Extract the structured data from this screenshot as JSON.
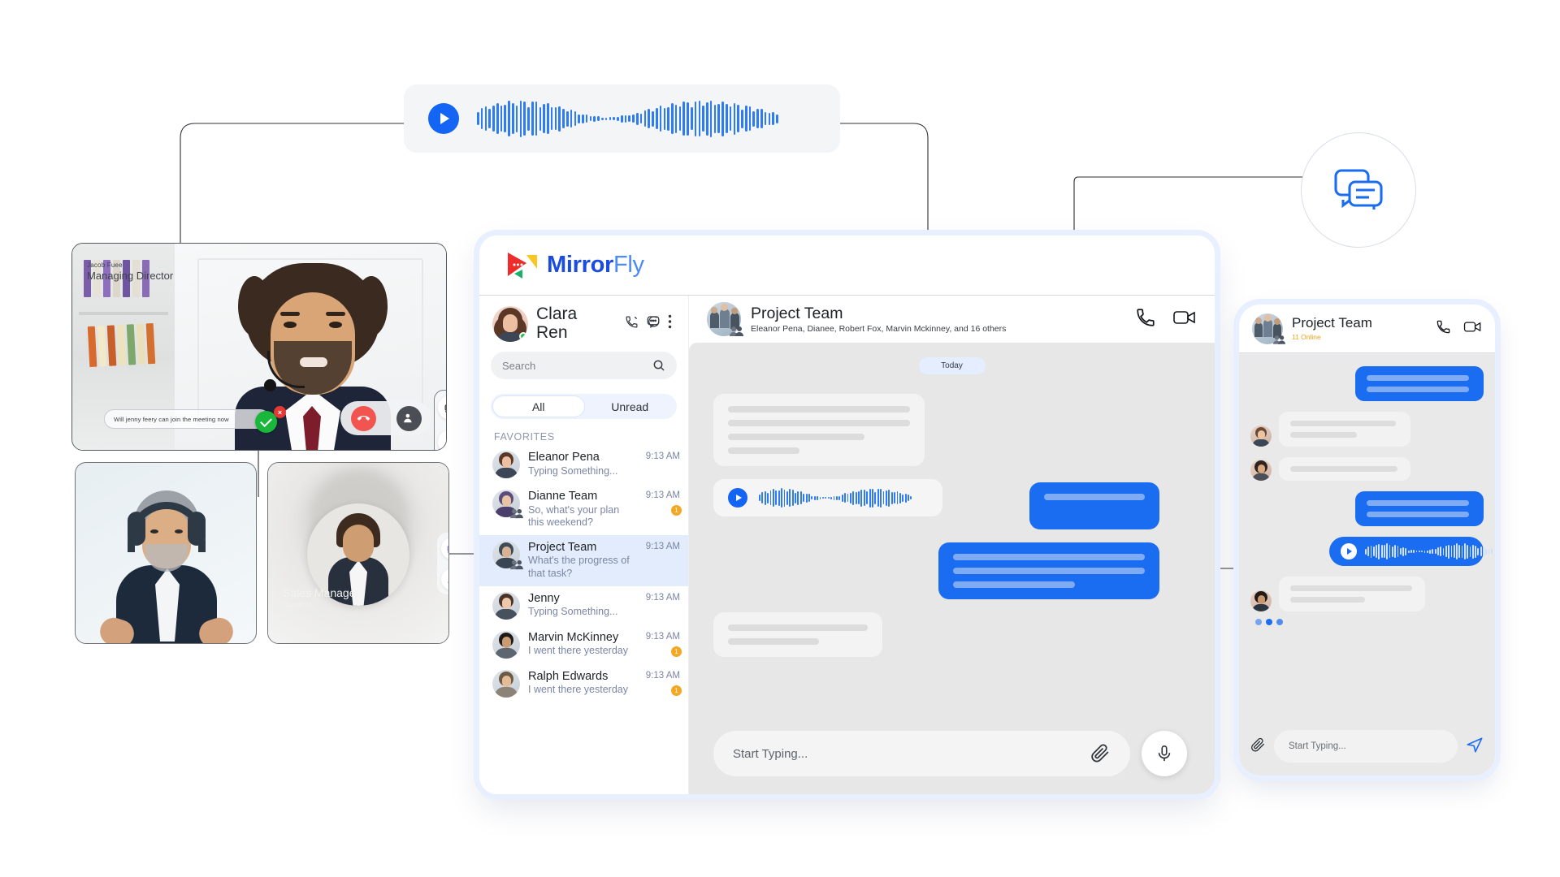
{
  "brand": {
    "name_bold": "Mirror",
    "name_light": "Fly",
    "logo_icon": "mirrorfly-logo-icon"
  },
  "audio_pill": {
    "play_icon": "play-icon",
    "waveform_icon": "audio-waveform"
  },
  "floating_chat_icon": "chat-bubbles-icon",
  "video_call": {
    "main_tile": {
      "participant_name": "Jacob Fuee",
      "participant_role": "Managing Director",
      "caption_text": "Will jenny feery can join the meeting now",
      "accept_icon": "check-circle-icon",
      "reject_badge": "x-badge-icon",
      "end_call_icon": "end-call-icon",
      "add_person_icon": "add-person-icon",
      "camera_off_icon": "camera-off-icon",
      "mic_off_icon": "mic-off-icon"
    },
    "tile_2": {
      "camera_off_icon": "camera-off-icon",
      "mic_off_icon": "mic-off-icon"
    },
    "tile_3": {
      "participant_name": "Sales Manager",
      "participant_role": "Daniel M.",
      "camera_off_icon": "camera-off-icon",
      "mic_off_icon": "mic-off-icon"
    }
  },
  "sidebar": {
    "me": {
      "name": "Clara Ren",
      "status": "online"
    },
    "header_icons": [
      {
        "name": "call-icon"
      },
      {
        "name": "new-chat-icon"
      },
      {
        "name": "more-vertical-icon"
      }
    ],
    "search": {
      "placeholder": "Search",
      "icon": "search-icon"
    },
    "filters": [
      {
        "label": "All",
        "selected": true
      },
      {
        "label": "Unread",
        "selected": false
      }
    ],
    "section_label": "FAVORITES",
    "chats": [
      {
        "name": "Eleanor Pena",
        "preview": "Typing Something...",
        "time": "9:13 AM",
        "unread": "",
        "selected": false,
        "group": false
      },
      {
        "name": "Dianne Team",
        "preview": "So, what's your plan this weekend?",
        "time": "9:13 AM",
        "unread": "1",
        "selected": false,
        "group": true
      },
      {
        "name": "Project Team",
        "preview": "What's the progress of that task?",
        "time": "9:13 AM",
        "unread": "",
        "selected": true,
        "group": true
      },
      {
        "name": "Jenny",
        "preview": "Typing Something...",
        "time": "9:13 AM",
        "unread": "",
        "selected": false,
        "group": false
      },
      {
        "name": "Marvin McKinney",
        "preview": "I went there yesterday",
        "time": "9:13 AM",
        "unread": "1",
        "selected": false,
        "group": false
      },
      {
        "name": "Ralph Edwards",
        "preview": "I went there yesterday",
        "time": "9:13 AM",
        "unread": "1",
        "selected": false,
        "group": false
      }
    ]
  },
  "conversation": {
    "title": "Project Team",
    "members": "Eleanor Pena, Dianee, Robert Fox, Marvin Mckinney, and 16 others",
    "group_icon": "group-badge-icon",
    "call_icon": "phone-icon",
    "video_icon": "video-camera-icon",
    "date_divider": "Today",
    "voice_message": {
      "play_icon": "play-icon",
      "waveform_icon": "audio-waveform"
    },
    "composer": {
      "placeholder": "Start Typing...",
      "attach_icon": "paperclip-icon",
      "mic_icon": "microphone-icon"
    }
  },
  "mobile": {
    "title": "Project Team",
    "status": "11 Online",
    "call_icon": "phone-icon",
    "video_icon": "video-camera-icon",
    "voice_message": {
      "play_icon": "play-icon",
      "waveform_icon": "audio-waveform"
    },
    "typing_indicator": "typing-dots",
    "composer": {
      "placeholder": "Start Typing...",
      "attach_icon": "paperclip-icon",
      "send_icon": "send-icon"
    }
  },
  "colors": {
    "brand_blue": "#1b4ce0",
    "accent_blue": "#1a6df0",
    "bubble_out": "#1a6df0",
    "badge_orange": "#f5a623",
    "online_green": "#21c24a",
    "end_call_red": "#f2554f"
  }
}
